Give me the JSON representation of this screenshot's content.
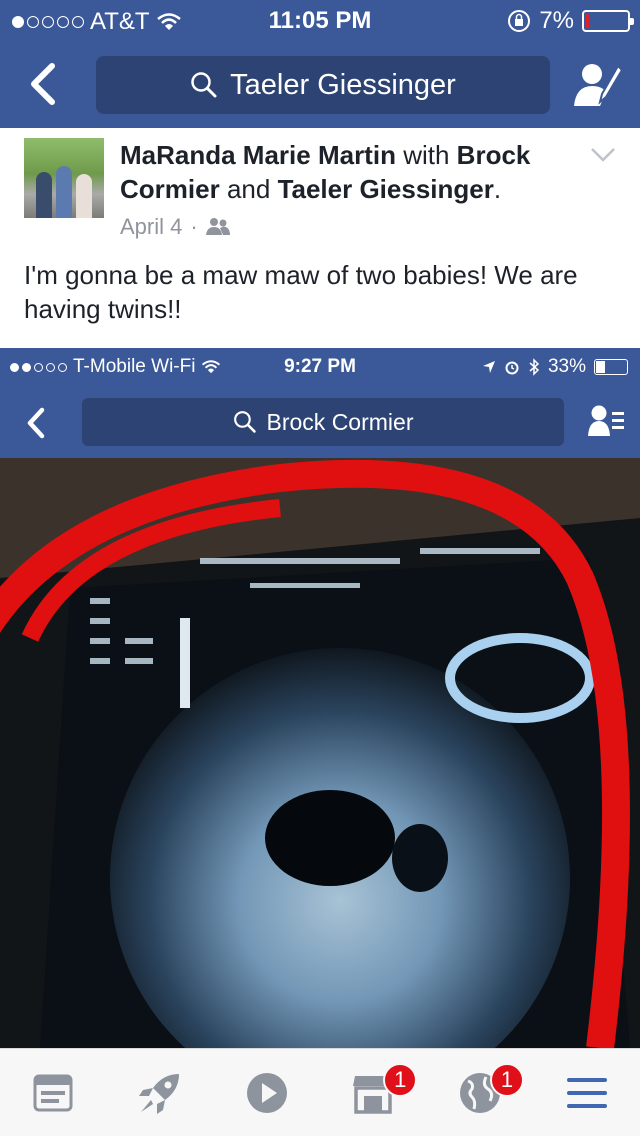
{
  "status_bar": {
    "carrier": "AT&T",
    "time": "11:05 PM",
    "battery": "7%",
    "battery_level": 0.07
  },
  "nav": {
    "search_text": "Taeler Giessinger"
  },
  "post": {
    "author": "MaRanda Marie Martin",
    "with_word": "with",
    "tagged_1": "Brock Cormier",
    "and_word": "and",
    "tagged_2": "Taeler Giessinger",
    "date": "April 4",
    "separator": "·",
    "privacy_icon": "friends-icon",
    "text": "I'm gonna be a maw maw of two babies! We are having twins!!"
  },
  "embedded": {
    "carrier": "T-Mobile Wi-Fi",
    "time": "9:27 PM",
    "battery": "33%",
    "battery_level": 0.33,
    "search_text": "Brock Cormier"
  },
  "tab_bar": {
    "tabs": [
      {
        "icon": "news-feed-icon"
      },
      {
        "icon": "rocket-icon"
      },
      {
        "icon": "video-play-icon"
      },
      {
        "icon": "marketplace-icon",
        "badge": "1"
      },
      {
        "icon": "globe-icon",
        "badge": "1"
      },
      {
        "icon": "menu-icon"
      }
    ],
    "accent": "#3b5998",
    "badge_color": "#e0101a"
  }
}
